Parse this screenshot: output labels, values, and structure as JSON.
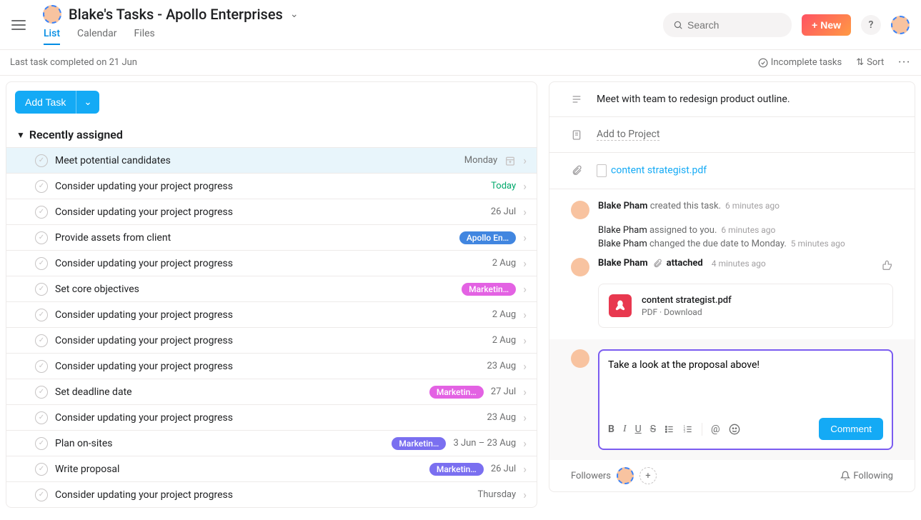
{
  "header": {
    "title": "Blake's Tasks - Apollo Enterprises",
    "tabs": [
      {
        "label": "List",
        "active": true
      },
      {
        "label": "Calendar",
        "active": false
      },
      {
        "label": "Files",
        "active": false
      }
    ],
    "search_placeholder": "Search",
    "new_label": "New"
  },
  "toolbar": {
    "last_completed": "Last task completed on 21 Jun",
    "filter": "Incomplete tasks",
    "sort": "Sort"
  },
  "add_task_label": "Add Task",
  "section_title": "Recently assigned",
  "tasks": [
    {
      "name": "Meet potential candidates",
      "date": "Monday",
      "date_class": "",
      "tag": null,
      "selected": true,
      "has_icon": true
    },
    {
      "name": "Consider updating your project progress",
      "date": "Today",
      "date_class": "today",
      "tag": null
    },
    {
      "name": "Consider updating your project progress",
      "date": "26 Jul",
      "tag": null
    },
    {
      "name": "Provide assets from client",
      "date": "",
      "tag": "Apollo En…",
      "tag_class": "blue"
    },
    {
      "name": "Consider updating your project progress",
      "date": "2 Aug",
      "tag": null
    },
    {
      "name": "Set core objectives",
      "date": "",
      "tag": "Marketin…",
      "tag_class": "pink"
    },
    {
      "name": "Consider updating your project progress",
      "date": "2 Aug",
      "tag": null
    },
    {
      "name": "Consider updating your project progress",
      "date": "2 Aug",
      "tag": null
    },
    {
      "name": "Consider updating your project progress",
      "date": "23 Aug",
      "tag": null
    },
    {
      "name": "Set deadline date",
      "date": "27 Jul",
      "tag": "Marketin…",
      "tag_class": "pink"
    },
    {
      "name": "Consider updating your project progress",
      "date": "23 Aug",
      "tag": null
    },
    {
      "name": "Plan on-sites",
      "date": "3 Jun – 23 Aug",
      "tag": "Marketin…",
      "tag_class": "purple"
    },
    {
      "name": "Write proposal",
      "date": "26 Jul",
      "tag": "Marketin…",
      "tag_class": "purple"
    },
    {
      "name": "Consider updating your project progress",
      "date": "Thursday",
      "tag": null
    }
  ],
  "detail": {
    "description": "Meet with team to redesign product outline.",
    "add_to_project": "Add to Project",
    "attachment": "content strategist.pdf"
  },
  "activity": {
    "created": {
      "actor": "Blake Pham",
      "text": "created this task.",
      "time": "6 minutes ago"
    },
    "lines": [
      {
        "actor": "Blake Pham",
        "text": "assigned to you.",
        "time": "6 minutes ago"
      },
      {
        "actor": "Blake Pham",
        "text": "changed the due date to Monday.",
        "time": "5 minutes ago"
      }
    ],
    "attached": {
      "actor": "Blake Pham",
      "verb": "attached",
      "time": "4 minutes ago"
    },
    "file": {
      "name": "content strategist.pdf",
      "meta": "PDF · Download"
    }
  },
  "comment": {
    "value": "Take a look at the proposal above!",
    "button": "Comment"
  },
  "followers": {
    "label": "Followers",
    "following": "Following"
  }
}
